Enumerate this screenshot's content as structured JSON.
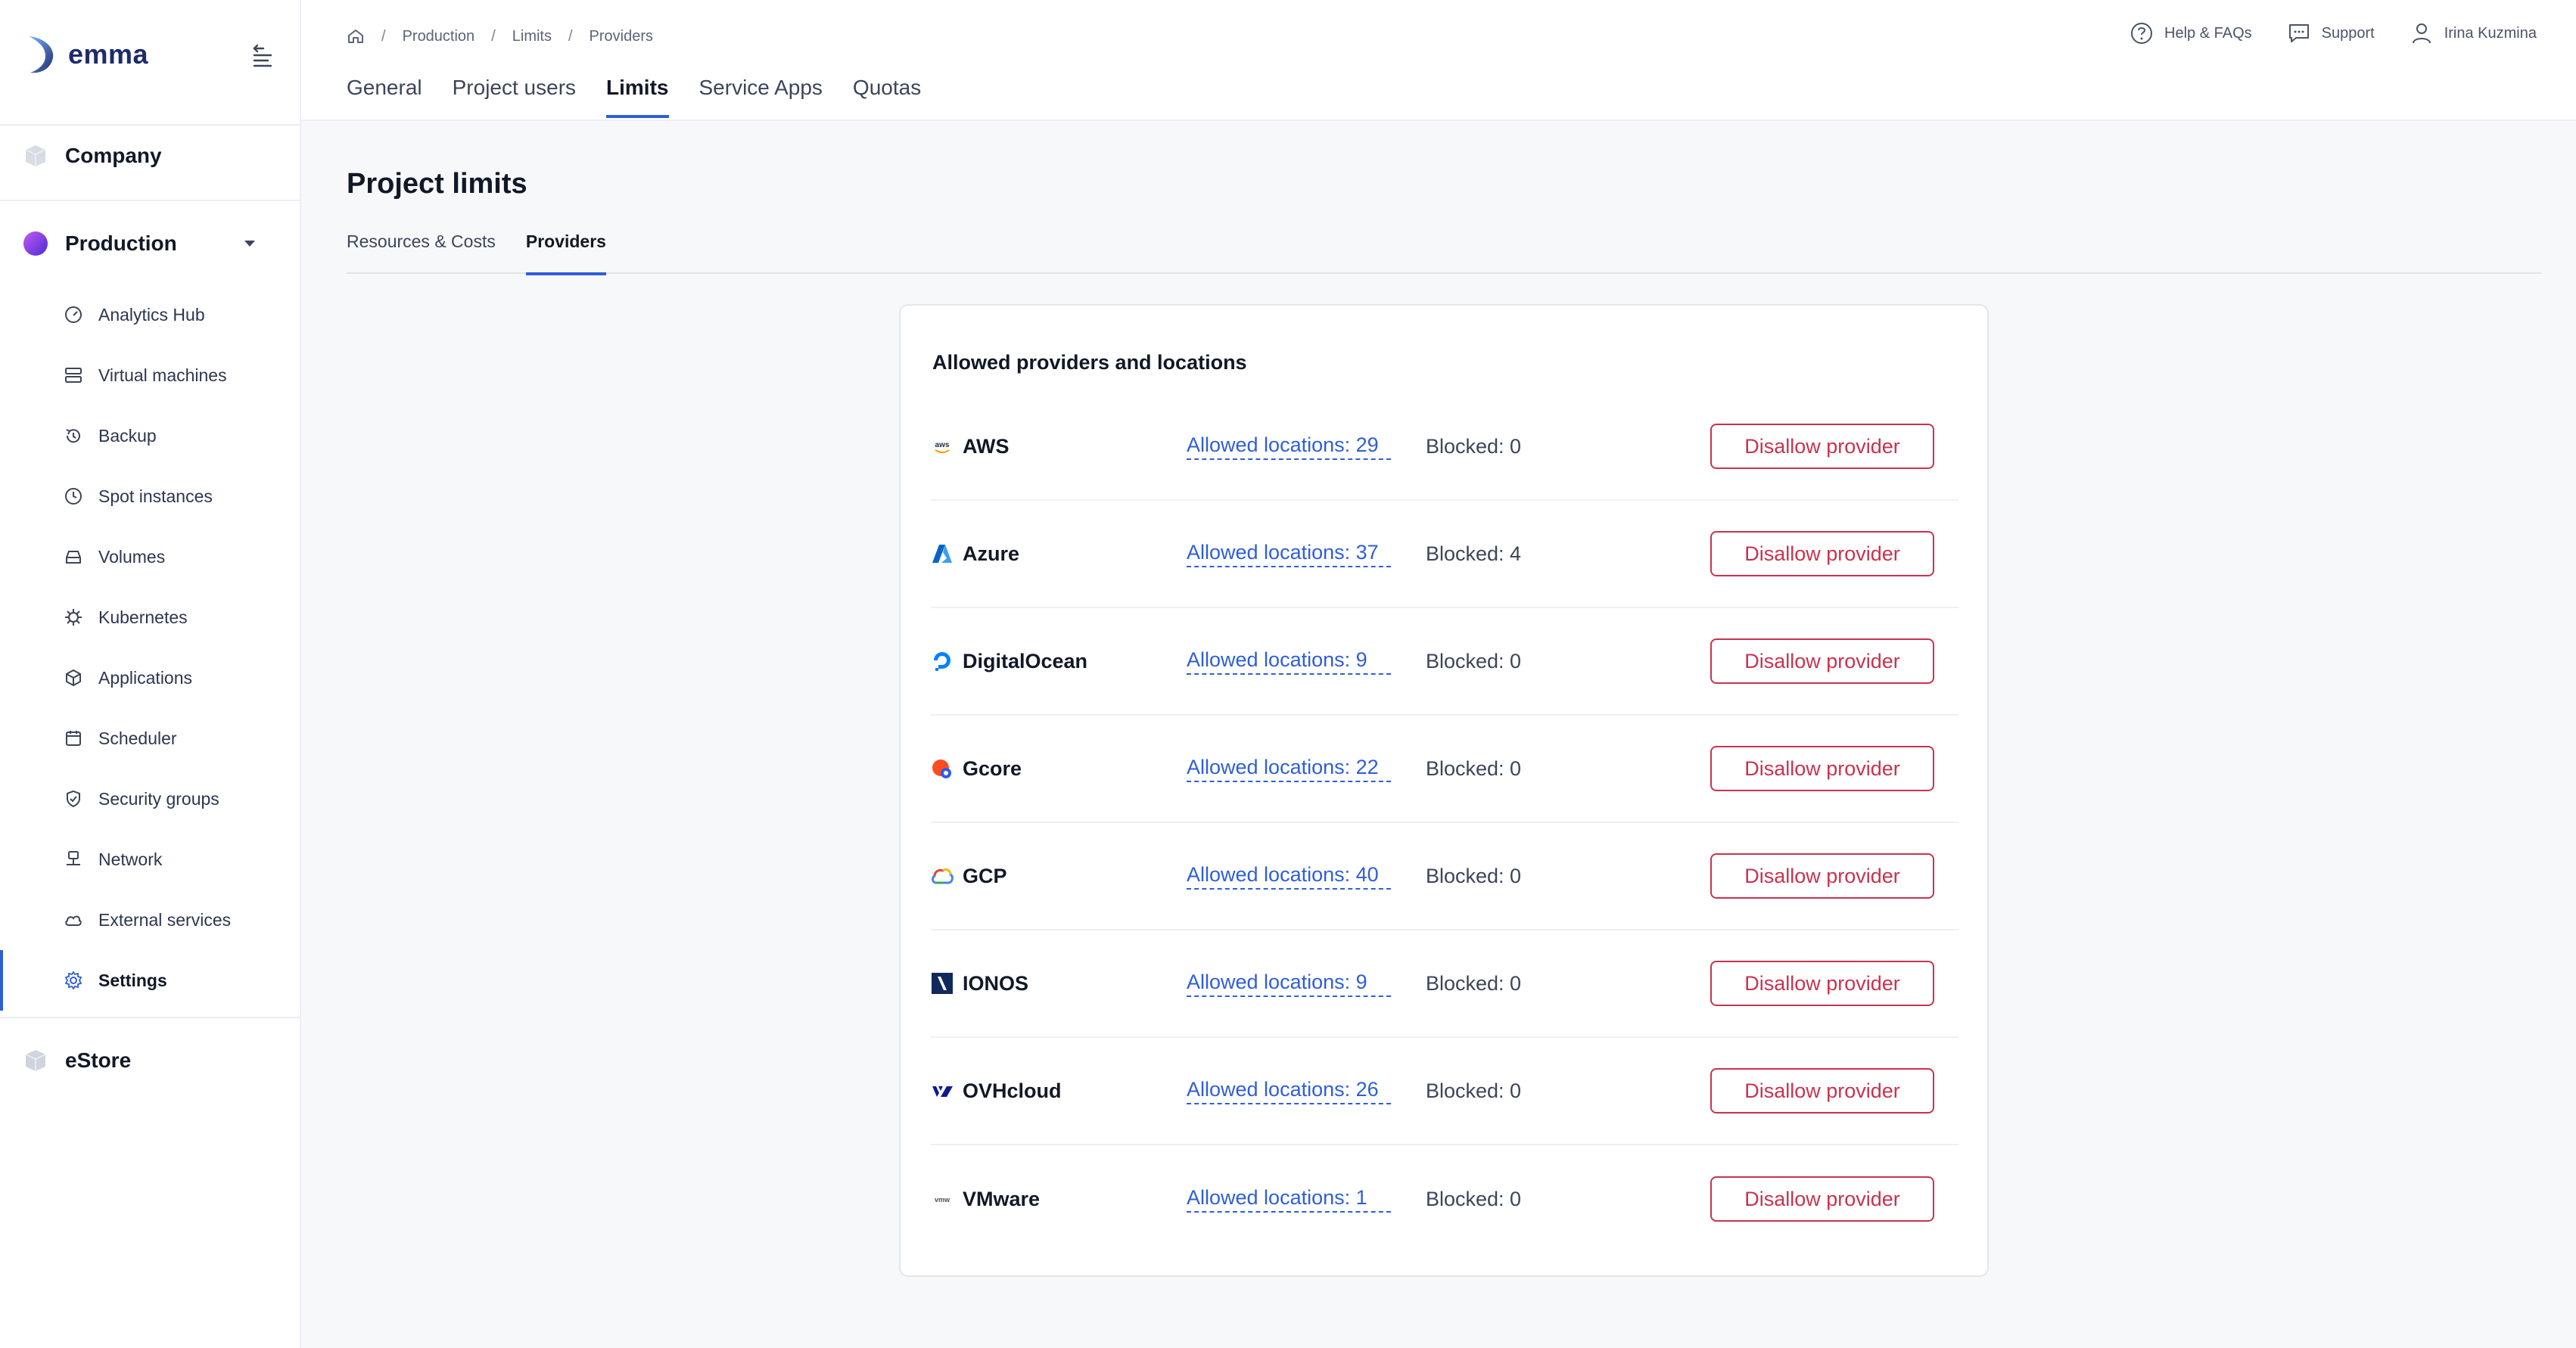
{
  "app": {
    "brand": "emma"
  },
  "colors": {
    "accent": "#2f5ed8",
    "danger": "#c8334f",
    "brand": "#1e2b6b"
  },
  "sidebar": {
    "company": {
      "label": "Company",
      "icon": "cube-icon"
    },
    "production": {
      "label": "Production",
      "icon": "project-dot-icon",
      "expanded": true,
      "items": [
        {
          "label": "Analytics Hub",
          "icon": "gauge-icon"
        },
        {
          "label": "Virtual machines",
          "icon": "server-icon"
        },
        {
          "label": "Backup",
          "icon": "history-icon"
        },
        {
          "label": "Spot instances",
          "icon": "clock-icon"
        },
        {
          "label": "Volumes",
          "icon": "drive-icon"
        },
        {
          "label": "Kubernetes",
          "icon": "helm-icon"
        },
        {
          "label": "Applications",
          "icon": "box-icon"
        },
        {
          "label": "Scheduler",
          "icon": "calendar-icon"
        },
        {
          "label": "Security groups",
          "icon": "shield-icon"
        },
        {
          "label": "Network",
          "icon": "network-icon"
        },
        {
          "label": "External services",
          "icon": "cloud-link-icon"
        },
        {
          "label": "Settings",
          "icon": "gear-icon",
          "active": true
        }
      ]
    },
    "estore": {
      "label": "eStore",
      "icon": "cube-icon"
    }
  },
  "header": {
    "breadcrumb": [
      "Production",
      "Limits",
      "Providers"
    ],
    "actions": {
      "help": "Help & FAQs",
      "support": "Support",
      "user": "Irina Kuzmina"
    },
    "tabs": [
      {
        "label": "General"
      },
      {
        "label": "Project users"
      },
      {
        "label": "Limits",
        "active": true
      },
      {
        "label": "Service Apps"
      },
      {
        "label": "Quotas"
      }
    ]
  },
  "main": {
    "title": "Project limits",
    "subtabs": [
      {
        "label": "Resources & Costs"
      },
      {
        "label": "Providers",
        "active": true
      }
    ],
    "card": {
      "title": "Allowed providers and locations",
      "providers": [
        {
          "name": "AWS",
          "icon": "aws-logo-icon",
          "allowed": "Allowed locations: 29",
          "blocked": "Blocked: 0",
          "action": "Disallow provider"
        },
        {
          "name": "Azure",
          "icon": "azure-logo-icon",
          "allowed": "Allowed locations: 37",
          "blocked": "Blocked: 4",
          "action": "Disallow provider"
        },
        {
          "name": "DigitalOcean",
          "icon": "digitalocean-logo-icon",
          "allowed": "Allowed locations: 9",
          "blocked": "Blocked: 0",
          "action": "Disallow provider"
        },
        {
          "name": "Gcore",
          "icon": "gcore-logo-icon",
          "allowed": "Allowed locations: 22",
          "blocked": "Blocked: 0",
          "action": "Disallow provider"
        },
        {
          "name": "GCP",
          "icon": "gcp-logo-icon",
          "allowed": "Allowed locations: 40",
          "blocked": "Blocked: 0",
          "action": "Disallow provider"
        },
        {
          "name": "IONOS",
          "icon": "ionos-logo-icon",
          "allowed": "Allowed locations: 9",
          "blocked": "Blocked: 0",
          "action": "Disallow provider"
        },
        {
          "name": "OVHcloud",
          "icon": "ovhcloud-logo-icon",
          "allowed": "Allowed locations: 26",
          "blocked": "Blocked: 0",
          "action": "Disallow provider"
        },
        {
          "name": "VMware",
          "icon": "vmware-logo-icon",
          "allowed": "Allowed locations: 1",
          "blocked": "Blocked: 0",
          "action": "Disallow provider"
        }
      ]
    }
  }
}
